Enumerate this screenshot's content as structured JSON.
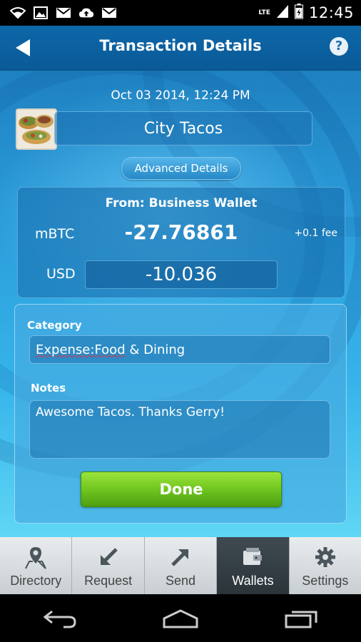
{
  "status_bar": {
    "time": "12:45",
    "network": "LTE",
    "icons": [
      "wifi-icon",
      "image-icon",
      "gmail-icon",
      "cloud-upload-icon",
      "gmail-icon"
    ]
  },
  "header": {
    "title": "Transaction Details",
    "help_label": "?"
  },
  "transaction": {
    "datetime": "Oct 03 2014, 12:24 PM",
    "payee": "City Tacos",
    "advanced_label": "Advanced Details",
    "from": "From: Business Wallet",
    "currency_label": "mBTC",
    "amount": "-27.76861",
    "fee": "+0.1 fee",
    "fiat_label": "USD",
    "fiat_amount": "-10.036"
  },
  "form": {
    "category_label": "Category",
    "category_value_part1": "Expense:Food",
    "category_value_part2": " & Dining",
    "notes_label": "Notes",
    "notes_value": "Awesome Tacos. Thanks Gerry!",
    "done_label": "Done"
  },
  "tabs": [
    {
      "label": "Directory",
      "icon": "map-pin-icon",
      "active": false
    },
    {
      "label": "Request",
      "icon": "arrow-down-left-icon",
      "active": false
    },
    {
      "label": "Send",
      "icon": "arrow-up-right-icon",
      "active": false
    },
    {
      "label": "Wallets",
      "icon": "wallet-icon",
      "active": true
    },
    {
      "label": "Settings",
      "icon": "gear-icon",
      "active": false
    }
  ],
  "colors": {
    "header": "#0d67a8",
    "done_button": "#6cc21e",
    "active_tab": "#2b3439"
  }
}
